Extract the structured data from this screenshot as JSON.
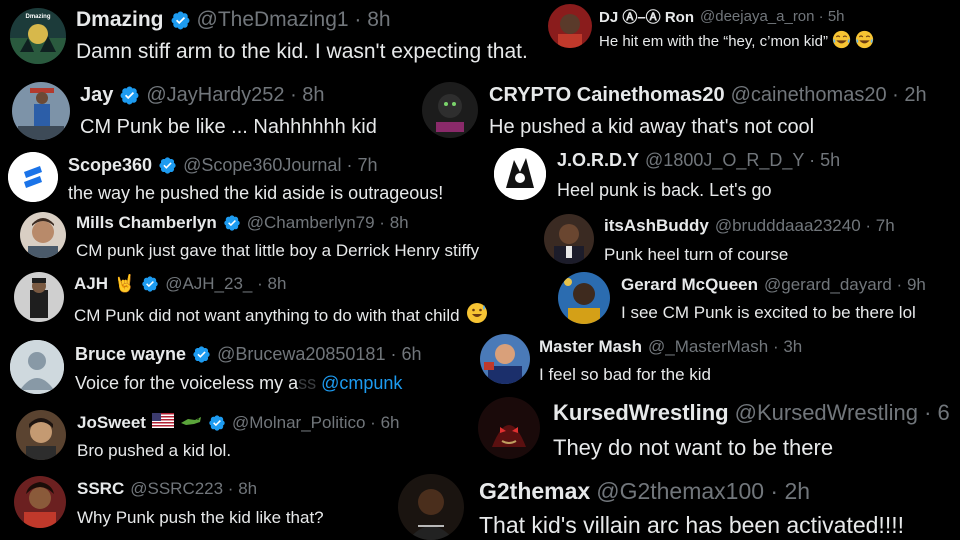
{
  "colors": {
    "background": "#000000",
    "text": "#e7e9ea",
    "handle": "#71767b",
    "verified": "#1d9bf0",
    "mention": "#1d9bf0"
  },
  "tweets": [
    {
      "name": "Dmazing",
      "handle": "@TheDmazing1 · 8h",
      "text": "Damn stiff arm to the kid. I wasn't expecting that.",
      "avatar_label": "Dmazing",
      "verified": true
    },
    {
      "name": "DJ Ⓐ–Ⓐ Ron",
      "handle": "@deejaya_a_ron · 5h",
      "text": "He hit em with the “hey, c’mon kid”",
      "verified": false
    },
    {
      "name": "Jay",
      "handle": "@JayHardy252 · 8h",
      "text": "CM Punk be like ... Nahhhhhh kid",
      "verified": true
    },
    {
      "name": "CRYPTO Cainethomas20",
      "handle": "@cainethomas20 · 2h",
      "text": "He pushed a kid away that's not cool",
      "verified": false
    },
    {
      "name": "Scope360",
      "handle": "@Scope360Journal · 7h",
      "text": "the way he pushed the kid aside is outrageous!",
      "verified": true
    },
    {
      "name": "J.O.R.D.Y",
      "handle": "@1800J_O_R_D_Y · 5h",
      "text": "Heel punk is back. Let's go",
      "verified": false
    },
    {
      "name": "Mills Chamberlyn",
      "handle": "@Chamberlyn79 · 8h",
      "text": "CM punk just gave that little boy a Derrick Henry stiffy",
      "verified": true
    },
    {
      "name": "itsAshBuddy",
      "handle": "@brudddaaa23240 · 7h",
      "text": "Punk heel turn of course",
      "verified": false
    },
    {
      "name": "AJH",
      "handle": "@AJH_23_ · 8h",
      "text": "CM Punk did not want anything to do with that child",
      "verified": true
    },
    {
      "name": "Gerard McQueen",
      "handle": "@gerard_dayard · 9h",
      "text": "I see CM Punk is excited to be there lol",
      "verified": false
    },
    {
      "name": "Bruce wayne",
      "handle": "@Brucewa20850181 · 6h",
      "text_pre": "Voice for the voiceless my a",
      "text_fade": "ss",
      "text_mention": " @cmpunk",
      "verified": true
    },
    {
      "name": "Master Mash",
      "handle": "@_MasterMash · 3h",
      "text": "I feel so bad for the kid",
      "verified": false
    },
    {
      "name": "JoSweet",
      "handle": "@Molnar_Politico · 6h",
      "text": "Bro pushed a kid lol.",
      "verified": true
    },
    {
      "name": "KursedWrestling",
      "handle": "@KursedWrestling · 6",
      "text": "They do not want to be there",
      "verified": false
    },
    {
      "name": "SSRC",
      "handle": "@SSRC223 · 8h",
      "text": "Why Punk push the kid like that?",
      "verified": false
    },
    {
      "name": "G2themax",
      "handle": "@G2themax100 · 2h",
      "text": "That kid's villain arc has been activated!!!!",
      "verified": false
    }
  ]
}
